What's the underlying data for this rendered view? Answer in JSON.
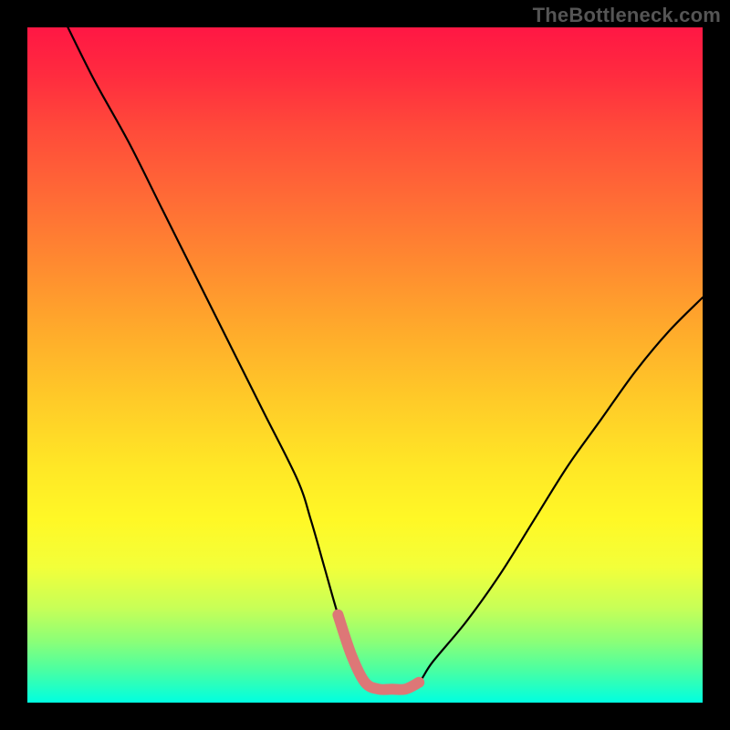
{
  "watermark": "TheBottleneck.com",
  "chart_data": {
    "type": "line",
    "title": "",
    "xlabel": "",
    "ylabel": "",
    "xlim": [
      0,
      100
    ],
    "ylim": [
      0,
      100
    ],
    "x": [
      6,
      10,
      15,
      20,
      25,
      30,
      35,
      40,
      42,
      44,
      46,
      48,
      50,
      52,
      54,
      56,
      58,
      60,
      65,
      70,
      75,
      80,
      85,
      90,
      95,
      100
    ],
    "values": [
      100,
      92,
      83,
      73,
      63,
      53,
      43,
      33,
      27,
      20,
      13,
      7,
      3,
      2,
      2,
      2,
      3,
      6,
      12,
      19,
      27,
      35,
      42,
      49,
      55,
      60
    ],
    "highlight_range_x": [
      46,
      58
    ],
    "gradient_stops": [
      {
        "pos": 0.0,
        "color": "#ff1744"
      },
      {
        "pos": 0.5,
        "color": "#ffca28"
      },
      {
        "pos": 0.8,
        "color": "#f2ff3a"
      },
      {
        "pos": 1.0,
        "color": "#00ffe0"
      }
    ]
  }
}
